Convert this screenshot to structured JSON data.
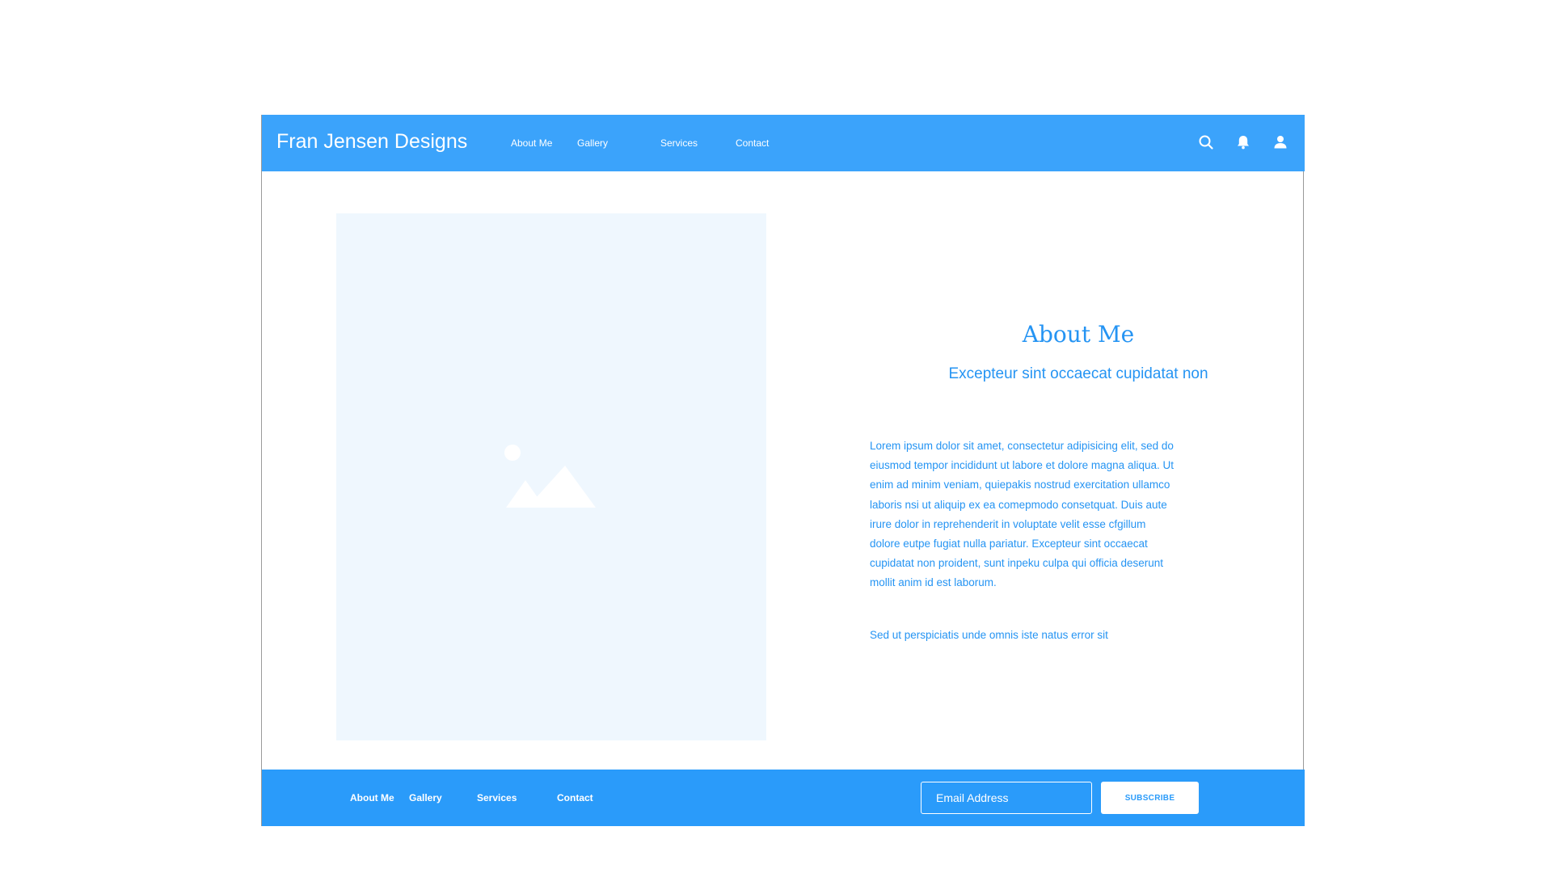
{
  "header": {
    "brand": "Fran Jensen Designs",
    "nav": [
      "About Me",
      "Gallery",
      "Services",
      "Contact"
    ],
    "icons": [
      "search-icon",
      "bell-icon",
      "user-icon"
    ]
  },
  "main": {
    "image_icon": "image-placeholder-icon",
    "title": "About Me",
    "subtitle": "Excepteur sint occaecat cupidatat non",
    "paragraph1": "Lorem ipsum dolor sit amet, consectetur adipisicing elit, sed do eiusmod tempor incididunt ut labore et dolore magna aliqua. Ut enim ad minim veniam, quiepakis nostrud exercitation ullamco laboris nsi ut aliquip ex ea comepmodo consetquat. Duis aute irure dolor in reprehenderit in voluptate velit esse cfgillum dolore eutpe fugiat nulla pariatur. Excepteur sint occaecat cupidatat non proident, sunt inpeku culpa qui officia deserunt mollit anim id est laborum.",
    "paragraph2": "Sed ut perspiciatis unde omnis iste natus error sit"
  },
  "footer": {
    "nav": [
      "About Me",
      "Gallery",
      "Services",
      "Contact"
    ],
    "email_placeholder": "Email Address",
    "subscribe_label": "SUBSCRIBE"
  },
  "colors": {
    "header_bg": "#3ba3fb",
    "footer_bg": "#2a9bfa",
    "accent_text": "#2594f3",
    "placeholder_bg": "#eff7fe"
  }
}
